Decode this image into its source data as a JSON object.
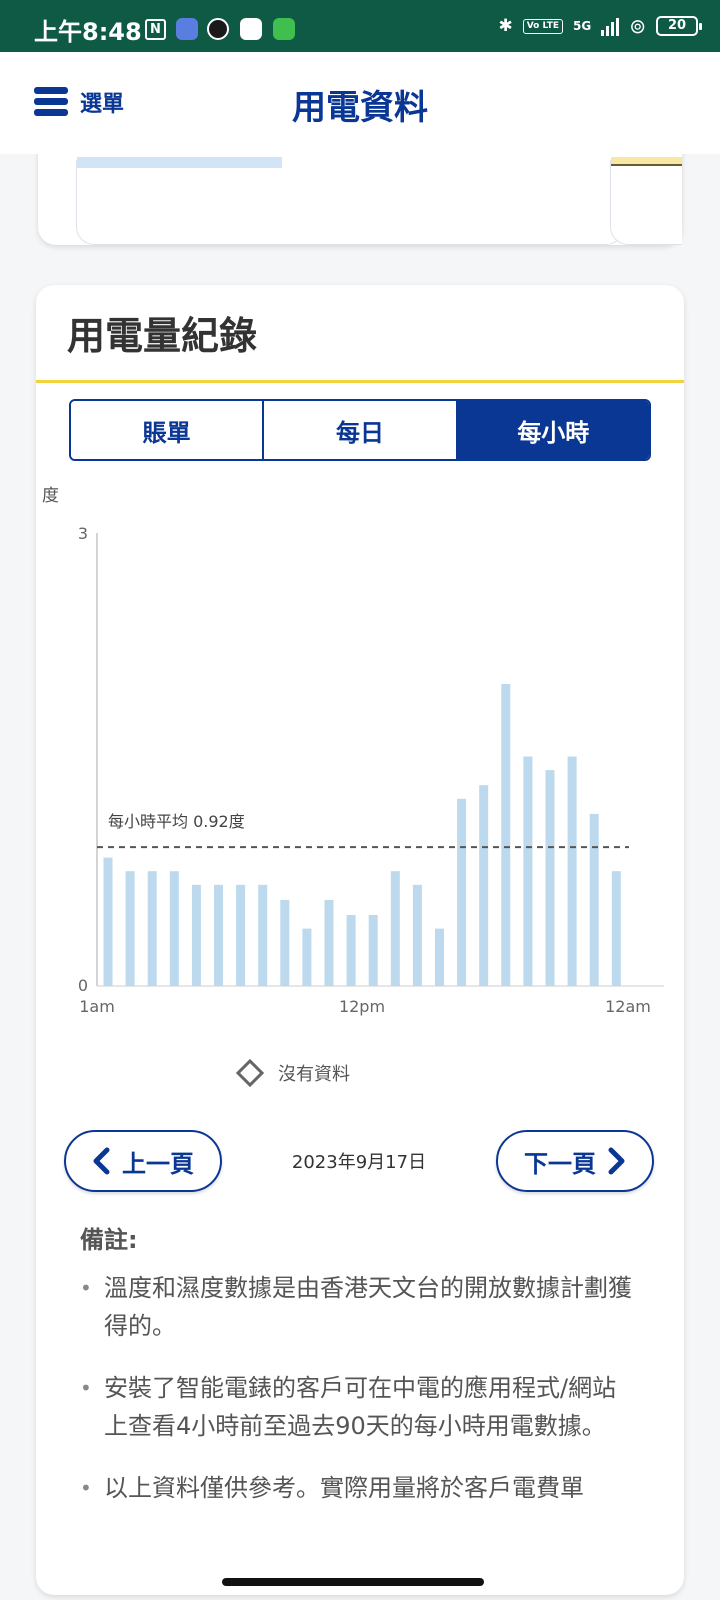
{
  "status_bar": {
    "time": "上午8:48",
    "nfc_label": "N",
    "network": "5G",
    "volte": "Vo LTE",
    "battery": "20"
  },
  "header": {
    "menu_label": "選單",
    "title": "用電資料"
  },
  "usage_card": {
    "heading": "用電量紀錄",
    "tabs": [
      {
        "label": "賬單",
        "active": false
      },
      {
        "label": "每日",
        "active": false
      },
      {
        "label": "每小時",
        "active": true
      }
    ],
    "legend_label": "沒有資料",
    "prev_label": "上一頁",
    "next_label": "下一頁",
    "date": "2023年9月17日"
  },
  "notes": {
    "title": "備註:",
    "items": [
      "溫度和濕度數據是由香港天文台的開放數據計劃獲得的。",
      "安裝了智能電錶的客戶可在中電的應用程式/網站上查看4小時前至過去90天的每小時用電數據。",
      "以上資料僅供參考。實際用量將於客戶電費單"
    ]
  },
  "colors": {
    "brand_blue": "#0a3694",
    "status_green": "#0e5a45",
    "bar_blue": "#bcd9ee",
    "divider_yellow": "#f3d23c"
  },
  "chart_data": {
    "type": "bar",
    "ylabel": "度",
    "ylim": [
      0,
      3
    ],
    "y_ticks": [
      "0",
      "3"
    ],
    "x_ticks": [
      "1am",
      "12pm",
      "12am"
    ],
    "categories": [
      "1am",
      "2am",
      "3am",
      "4am",
      "5am",
      "6am",
      "7am",
      "8am",
      "9am",
      "10am",
      "11am",
      "12pm",
      "1pm",
      "2pm",
      "3pm",
      "4pm",
      "5pm",
      "6pm",
      "7pm",
      "8pm",
      "9pm",
      "10pm",
      "11pm",
      "12am"
    ],
    "values": [
      0.85,
      0.76,
      0.76,
      0.76,
      0.67,
      0.67,
      0.67,
      0.67,
      0.57,
      0.38,
      0.57,
      0.47,
      0.47,
      0.76,
      0.67,
      0.38,
      1.24,
      1.33,
      2.0,
      1.52,
      1.43,
      1.52,
      1.14,
      0.76
    ],
    "average": 0.92,
    "average_label": "每小時平均 0.92度",
    "grid": false
  }
}
